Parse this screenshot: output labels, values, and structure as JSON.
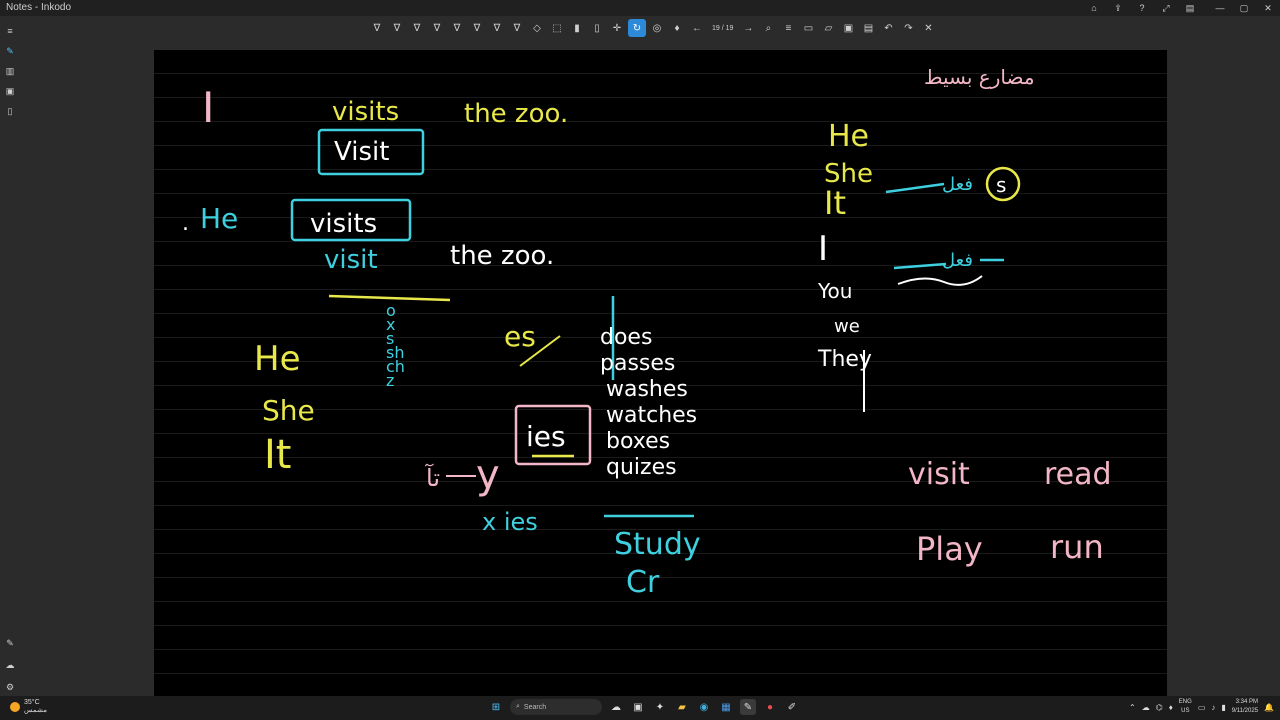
{
  "window": {
    "title": "Notes - Inkodo"
  },
  "toolbar": {
    "page_indicator": "19 / 19",
    "tools": [
      {
        "name": "pen-white-icon",
        "glyph": "∇"
      },
      {
        "name": "pen-blue-icon",
        "glyph": "∇"
      },
      {
        "name": "pen-green-icon",
        "glyph": "∇"
      },
      {
        "name": "pen-yellow-icon",
        "glyph": "∇"
      },
      {
        "name": "pen-pink-icon",
        "glyph": "∇"
      },
      {
        "name": "pen-cyan-icon",
        "glyph": "∇"
      },
      {
        "name": "pen-teal-icon",
        "glyph": "∇"
      },
      {
        "name": "pen-alt-icon",
        "glyph": "∇"
      },
      {
        "name": "eraser-icon",
        "glyph": "◇"
      },
      {
        "name": "select-icon",
        "glyph": "⬚"
      },
      {
        "name": "highlighter-icon",
        "glyph": "▮"
      },
      {
        "name": "ruler-icon",
        "glyph": "▯"
      },
      {
        "name": "laser-icon",
        "glyph": "✛"
      },
      {
        "name": "lasso-icon",
        "glyph": "↻",
        "active": true
      },
      {
        "name": "shapes-icon",
        "glyph": "◎"
      },
      {
        "name": "mic-icon",
        "glyph": "♦"
      }
    ],
    "nav": [
      {
        "name": "prev-page-icon",
        "glyph": "←"
      },
      {
        "name": "next-page-icon",
        "glyph": "→"
      },
      {
        "name": "zoom-icon",
        "glyph": "⌕"
      },
      {
        "name": "settings-sliders-icon",
        "glyph": "≡"
      },
      {
        "name": "new-page-icon",
        "glyph": "▭"
      },
      {
        "name": "open-folder-icon",
        "glyph": "▱"
      },
      {
        "name": "save-icon",
        "glyph": "▣"
      },
      {
        "name": "export-icon",
        "glyph": "▤"
      },
      {
        "name": "undo-icon",
        "glyph": "↶"
      },
      {
        "name": "redo-icon",
        "glyph": "↷"
      },
      {
        "name": "close-doc-icon",
        "glyph": "✕"
      }
    ]
  },
  "notes": {
    "yellow": "#e8e84a",
    "cyan": "#3fd0e0",
    "pink": "#f2b6c6",
    "white": "#ffffff",
    "row1": {
      "subject": "I",
      "verb": "visits",
      "verb_fixed": "Visit",
      "object": "the zoo."
    },
    "row2": {
      "subject": "He",
      "verb": "visits",
      "verb_wrong": "visit",
      "object": "the zoo."
    },
    "he_she_it": [
      "He",
      "She",
      "It"
    ],
    "letters": [
      "o",
      "x",
      "s",
      "sh",
      "ch",
      "z"
    ],
    "es_label": "es",
    "es_words": [
      "does",
      "passes",
      "washes",
      "watches",
      "boxes",
      "quizes"
    ],
    "ies_label": "ies",
    "y_rule": "y",
    "x_ies": "x ies",
    "y_arabic": "تآ",
    "study_words": [
      "Study",
      "Cr"
    ],
    "right_title": "مضارع بسيط",
    "right_he_she_it": [
      "He",
      "She",
      "It"
    ],
    "s_circle": "s",
    "fi3l_1": "فعل",
    "fi3l_2": "فعل",
    "pronouns": [
      "I",
      "You",
      "we",
      "They"
    ],
    "pink_words": [
      "visit",
      "read",
      "Play",
      "run"
    ]
  },
  "taskbar": {
    "weather_temp": "35°C",
    "weather_desc": "مشمس",
    "search_label": "Search",
    "lang_1": "ENG",
    "lang_2": "US",
    "time": "3:34 PM",
    "date": "9/11/2025"
  }
}
